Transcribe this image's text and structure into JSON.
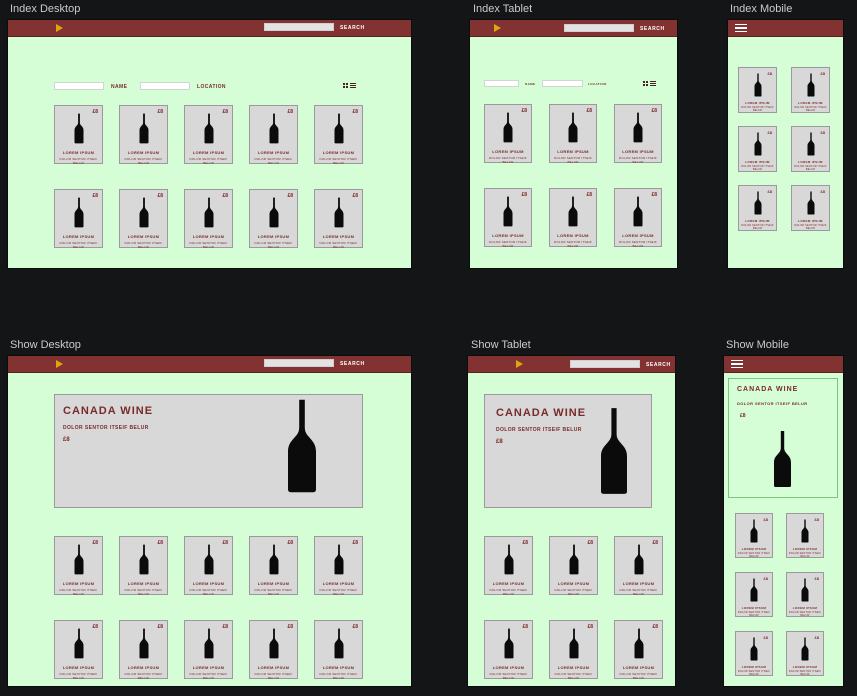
{
  "labels": {
    "index_desktop": "Index Desktop",
    "index_tablet": "Index Tablet",
    "index_mobile": "Index Mobile",
    "show_desktop": "Show Desktop",
    "show_tablet": "Show Tablet",
    "show_mobile": "Show Mobile"
  },
  "nav": {
    "search_label": "SEARCH"
  },
  "filters": {
    "name_label": "NAME",
    "location_label": "LOCATION"
  },
  "card": {
    "price": "£8",
    "title": "LOREM IPSUM",
    "subtitle": "DOLOR SENTOR ITSEIF BELUR"
  },
  "hero": {
    "title": "CANADA WINE",
    "subtitle": "DOLOR SENTOR ITSEIF BELUR",
    "price": "£8"
  },
  "colors": {
    "nav": "#833232",
    "accent": "#e0a412",
    "frame": "#d6fed6",
    "card": "#d8d8d8",
    "text": "#7a2a2a"
  }
}
